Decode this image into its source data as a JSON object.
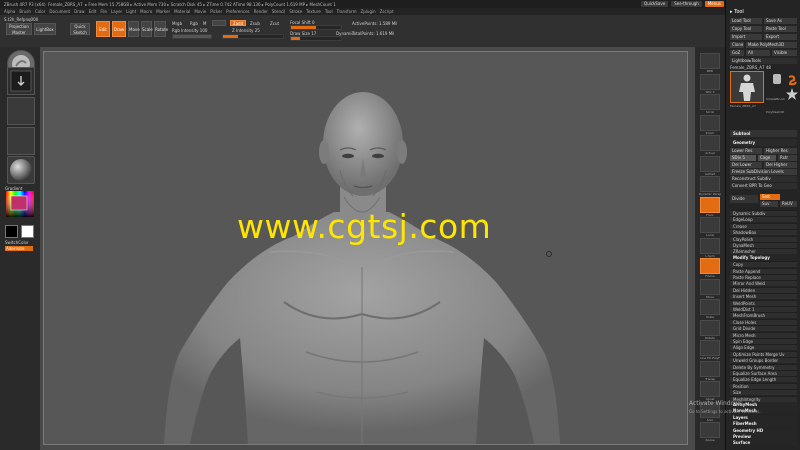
{
  "app": {
    "title": "ZBrush 4R7 P3 (x64)",
    "document": "Female_ZBRS_A7",
    "status": "▸ Free Mem 15.758GB ▸ Active Mem 730 ▸ Scratch Disk 45 ▸ ZTime 0.742 ATime 98.136 ▸ PolyCount 1.619 MP ▸ MeshCount 1",
    "quicksave_label": "QuickSave",
    "see_through_label": "See-through",
    "menus_label": "Menus",
    "default_script_label": "DefaultZScript"
  },
  "menubar": {
    "items": [
      "Alpha",
      "Brush",
      "Color",
      "Document",
      "Draw",
      "Edit",
      "File",
      "Layer",
      "Light",
      "Macro",
      "Marker",
      "Material",
      "Movie",
      "Picker",
      "Preferences",
      "Render",
      "Stencil",
      "Stroke",
      "Texture",
      "Tool",
      "Transform",
      "Zplugin",
      "Zscript"
    ]
  },
  "toolbar": {
    "projection_master": "Projection Master",
    "lightbox": "LightBox",
    "quick_sketch": "Quick Sketch",
    "edit": "Edit",
    "draw": "Draw",
    "move": "Move",
    "scale": "Scale",
    "rotate": "Rotate",
    "mrgb": "Mrgb",
    "rgb": "Rgb",
    "m": "M",
    "zadd": "Zadd",
    "zsub": "Zsub",
    "zcut": "Zcut",
    "rgb_intensity": "Rgb Intensity 100",
    "z_intensity": "Z Intensity 25",
    "focal_shift": "Focal Shift 0",
    "draw_size": "Draw Size 17",
    "dynamic": "Dynamic",
    "active_points": "ActivePoints: 1.589 Mil",
    "total_points": "TotalPoints: 1.619 Mil",
    "brush_name": "S.t2h_Refpnq000"
  },
  "left_shelf": {
    "gradient_label": "Gradient",
    "switch_color_label": "SwitchColor",
    "alternate_label": "Alternate",
    "colors": {
      "main": "#000000",
      "secondary": "#ffffff",
      "accent": "#e36c12"
    }
  },
  "right_shelf": {
    "buttons": [
      "BPR",
      "SPix 3",
      "Scroll",
      "Zoom",
      "Actual",
      "AAHalf",
      "Dynamic Persp",
      "Floor",
      "Local",
      "L.Sym",
      "Frame",
      "Move",
      "Scale",
      "Rotate",
      "Line Fill PolyF",
      "Transp",
      "Ghost",
      "Solo",
      "Xpose"
    ]
  },
  "tray": {
    "tool_title": "Tool",
    "load_tool": "Load Tool",
    "save_as": "Save As",
    "copy_tool": "Copy Tool",
    "paste_tool": "Paste Tool",
    "import": "Import",
    "export": "Export",
    "clone": "Clone",
    "make_polymesh": "Make PolyMesh3D",
    "goz": "GoZ",
    "all": "All",
    "visible": "Visible",
    "lightbox_tools": "Lightbox▸Tools",
    "current_tool": "Female_ZBRS_A7",
    "tool_count": "48",
    "thumb_labels": [
      "Female_ZBRS_A7",
      "SimpleBrush",
      "PolyMesh3D"
    ],
    "subtool": "Subtool",
    "geometry": "Geometry",
    "lower_res": "Lower Res",
    "higher_res": "Higher Res",
    "sdiv": "SDiv 5",
    "cage": "Cage",
    "rstr": "Rstr",
    "del_lower": "Del Lower",
    "del_higher": "Del Higher",
    "freeze_subdiv": "Freeze SubDivision Levels",
    "reconstruct_subdiv": "Reconstruct Subdiv",
    "convert_bpr": "Convert BPR To Geo",
    "divide": "Divide",
    "smt": "Smt",
    "suv": "Suv",
    "rsmt": "ReUV",
    "items": [
      "Dynamic Subdiv",
      "EdgeLoop",
      "Crease",
      "ShadowBox",
      "ClayPolish",
      "DynaMesh",
      "ZRemesher",
      "Modify Topology",
      "Copy",
      "Paste Append",
      "Paste Replace",
      "Mirror And Weld",
      "Del Hidden",
      "Insert Mesh",
      "WeldPoints",
      "WeldDist 1",
      "MeshFromBrush",
      "Close Holes",
      "Grid Divide",
      "Micro Mesh",
      "Spin Edge",
      "Align Edge",
      "Optimize Points Merge Uv",
      "Unweld Groups Border",
      "Delete By Symmetry",
      "Equalize Surface Area",
      "Equalize Edge Length",
      "Position",
      "Size",
      "MeshIntegrity",
      "ArrayMesh",
      "NanoMesh",
      "Layers",
      "FiberMesh",
      "Geometry HD",
      "Preview",
      "Surface"
    ]
  },
  "overlays": {
    "watermark": "www.cgtsj.com",
    "activate_windows": "Activate Windows",
    "activate_windows_sub": "Go to Settings to activate Windows."
  },
  "canvas": {
    "bg": "#575757",
    "skin": "#8e8e8e"
  }
}
